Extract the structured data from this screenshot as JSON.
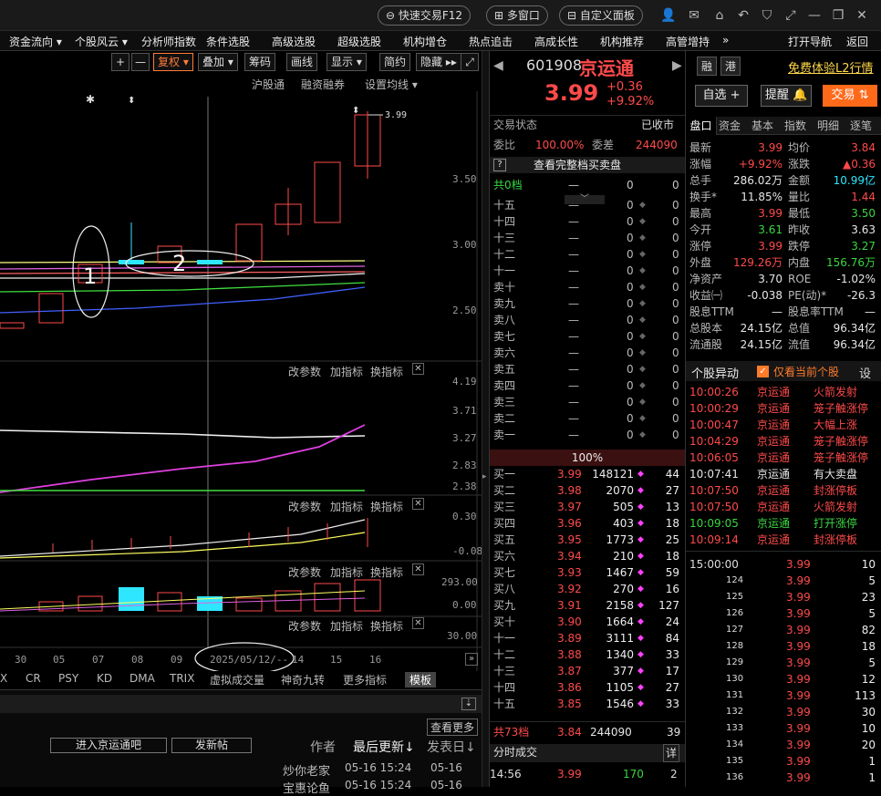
{
  "topbar": {
    "quick_trade": "快速交易F12",
    "multi_window": "多窗口",
    "custom_panel": "自定义面板"
  },
  "menu": [
    "资金流向 ▾",
    "个股风云 ▾",
    "分析师指数",
    "条件选股",
    "高级选股",
    "超级选股",
    "机构增仓",
    "热点追击",
    "高成长性",
    "机构推荐",
    "高管增持",
    "»",
    "打开导航",
    "返回"
  ],
  "chart_toolbar": {
    "fuquan": "复权 ▾",
    "diejia": "叠加 ▾",
    "chouma": "筹码",
    "huaxian": "画线",
    "xianshi": "显示 ▾",
    "jianyue": "简约",
    "yincang": "隐藏 ▸▸"
  },
  "chart_links": [
    "沪股通",
    "融资融券",
    "设置均线 ▾"
  ],
  "price_axis": [
    "3.50",
    "3.00",
    "2.50"
  ],
  "last_price_tag": "3.99",
  "annotations": [
    "1",
    "2"
  ],
  "sub_panels": [
    {
      "labels": [
        "改参数",
        "加指标",
        "换指标"
      ],
      "axis": [
        "4.19",
        "3.71",
        "3.27",
        "2.83",
        "2.38"
      ]
    },
    {
      "labels": [
        "改参数",
        "加指标",
        "换指标"
      ],
      "axis": [
        "0.30",
        "-0.08"
      ]
    },
    {
      "labels": [
        "改参数",
        "加指标",
        "换指标"
      ],
      "axis": [
        "293.00",
        "0.00"
      ]
    },
    {
      "labels": [
        "改参数",
        "加指标",
        "换指标"
      ],
      "axis": [
        "30.00"
      ]
    }
  ],
  "date_axis": [
    "30",
    "05",
    "07",
    "08",
    "09",
    "2025/05/12/--",
    "14",
    "15",
    "16"
  ],
  "indicator_tabs": [
    "X",
    "CR",
    "PSY",
    "KD",
    "DMA",
    "TRIX",
    "虚拟成交量",
    "神奇九转",
    "更多指标",
    "模板"
  ],
  "lower": {
    "more": "查看更多",
    "enter_bar": "进入京运通吧",
    "new_post": "发新帖",
    "author": "作者",
    "last_update": "最后更新↓",
    "post_date": "发表日↓",
    "posts": [
      {
        "author": "炒你老家",
        "update": "05-16 15:24",
        "date": "05-16"
      },
      {
        "author": "宝惠论鱼",
        "update": "05-16 15:24",
        "date": "05-16"
      }
    ]
  },
  "stock": {
    "code": "601908",
    "name": "京运通",
    "price": "3.99",
    "change": "+0.36",
    "change_pct": "+9.92%",
    "rong": "融",
    "gang": "港",
    "l2": "免费体验L2行情",
    "zixuan": "自选 +",
    "tixing": "提醒 🔔",
    "jiaoyi": "交易 ⇅"
  },
  "trade_status": {
    "label": "交易状态",
    "value": "已收市"
  },
  "weibi": {
    "label": "委比",
    "pct": "100.00%",
    "wc_label": "委差",
    "wc": "244090"
  },
  "full_book": "查看完整档买卖盘",
  "sell_header": {
    "label": "共0档",
    "a": "—",
    "b": "0",
    "c": "0"
  },
  "sells": [
    {
      "l": "十五",
      "p": "—",
      "v": "0",
      "n": "0"
    },
    {
      "l": "十四",
      "p": "—",
      "v": "0",
      "n": "0"
    },
    {
      "l": "十三",
      "p": "—",
      "v": "0",
      "n": "0"
    },
    {
      "l": "十二",
      "p": "—",
      "v": "0",
      "n": "0"
    },
    {
      "l": "十一",
      "p": "—",
      "v": "0",
      "n": "0"
    },
    {
      "l": "卖十",
      "p": "—",
      "v": "0",
      "n": "0"
    },
    {
      "l": "卖九",
      "p": "—",
      "v": "0",
      "n": "0"
    },
    {
      "l": "卖八",
      "p": "—",
      "v": "0",
      "n": "0"
    },
    {
      "l": "卖七",
      "p": "—",
      "v": "0",
      "n": "0"
    },
    {
      "l": "卖六",
      "p": "—",
      "v": "0",
      "n": "0"
    },
    {
      "l": "卖五",
      "p": "—",
      "v": "0",
      "n": "0"
    },
    {
      "l": "卖四",
      "p": "—",
      "v": "0",
      "n": "0"
    },
    {
      "l": "卖三",
      "p": "—",
      "v": "0",
      "n": "0"
    },
    {
      "l": "卖二",
      "p": "—",
      "v": "0",
      "n": "0"
    },
    {
      "l": "卖一",
      "p": "—",
      "v": "0",
      "n": "0"
    }
  ],
  "ratio_bar": "100%",
  "buys": [
    {
      "l": "买一",
      "p": "3.99",
      "v": "148121",
      "n": "44"
    },
    {
      "l": "买二",
      "p": "3.98",
      "v": "2070",
      "n": "27"
    },
    {
      "l": "买三",
      "p": "3.97",
      "v": "505",
      "n": "13"
    },
    {
      "l": "买四",
      "p": "3.96",
      "v": "403",
      "n": "18"
    },
    {
      "l": "买五",
      "p": "3.95",
      "v": "1773",
      "n": "25"
    },
    {
      "l": "买六",
      "p": "3.94",
      "v": "210",
      "n": "18"
    },
    {
      "l": "买七",
      "p": "3.93",
      "v": "1467",
      "n": "59"
    },
    {
      "l": "买八",
      "p": "3.92",
      "v": "270",
      "n": "16"
    },
    {
      "l": "买九",
      "p": "3.91",
      "v": "2158",
      "n": "127"
    },
    {
      "l": "买十",
      "p": "3.90",
      "v": "1664",
      "n": "24"
    },
    {
      "l": "十一",
      "p": "3.89",
      "v": "3111",
      "n": "84"
    },
    {
      "l": "十二",
      "p": "3.88",
      "v": "1340",
      "n": "33"
    },
    {
      "l": "十三",
      "p": "3.87",
      "v": "377",
      "n": "17"
    },
    {
      "l": "十四",
      "p": "3.86",
      "v": "1105",
      "n": "27"
    },
    {
      "l": "十五",
      "p": "3.85",
      "v": "1546",
      "n": "33"
    }
  ],
  "buy_footer": {
    "label": "共73档",
    "p": "3.84",
    "v": "244090",
    "n": "39"
  },
  "fenshi": {
    "title": "分时成交",
    "detail": "详",
    "time": "14:56",
    "price": "3.99",
    "vol": "170",
    "n": "2"
  },
  "right_tabs": [
    "盘口",
    "资金",
    "基本",
    "指数",
    "明细",
    "逐笔"
  ],
  "quote": [
    {
      "a": "最新",
      "av": "3.99",
      "b": "均价",
      "bv": "3.84",
      "ac": "red",
      "bc": "red"
    },
    {
      "a": "涨幅",
      "av": "+9.92%",
      "b": "涨跌",
      "bv": "▲0.36",
      "ac": "red",
      "bc": "red"
    },
    {
      "a": "总手",
      "av": "286.02万",
      "b": "金额",
      "bv": "10.99亿",
      "ac": "wht",
      "bc": "cyan"
    },
    {
      "a": "换手*",
      "av": "11.85%",
      "b": "量比",
      "bv": "1.44",
      "ac": "wht",
      "bc": "red"
    },
    {
      "a": "最高",
      "av": "3.99",
      "b": "最低",
      "bv": "3.50",
      "ac": "red",
      "bc": "grn"
    },
    {
      "a": "今开",
      "av": "3.61",
      "b": "昨收",
      "bv": "3.63",
      "ac": "grn",
      "bc": "wht"
    },
    {
      "a": "涨停",
      "av": "3.99",
      "b": "跌停",
      "bv": "3.27",
      "ac": "red",
      "bc": "grn"
    },
    {
      "a": "外盘",
      "av": "129.26万",
      "b": "内盘",
      "bv": "156.76万",
      "ac": "red",
      "bc": "grn"
    },
    {
      "a": "净资产",
      "av": "3.70",
      "b": "ROE",
      "bv": "-1.02%",
      "ac": "wht",
      "bc": "wht"
    },
    {
      "a": "收益㈠",
      "av": "-0.038",
      "b": "PE(动)*",
      "bv": "-26.3",
      "ac": "wht",
      "bc": "wht"
    },
    {
      "a": "股息TTM",
      "av": "—",
      "b": "股息率TTM",
      "bv": "—",
      "ac": "wht",
      "bc": "wht"
    },
    {
      "a": "总股本",
      "av": "24.15亿",
      "b": "总值",
      "bv": "96.34亿",
      "ac": "wht",
      "bc": "wht"
    },
    {
      "a": "流通股",
      "av": "24.15亿",
      "b": "流值",
      "bv": "96.34亿",
      "ac": "wht",
      "bc": "wht"
    }
  ],
  "yidong": {
    "title": "个股异动",
    "only_current": "仅看当前个股",
    "settings": "设"
  },
  "alerts": [
    {
      "t": "10:00:26",
      "n": "京运通",
      "e": "火箭发射",
      "c": "red"
    },
    {
      "t": "10:00:29",
      "n": "京运通",
      "e": "笼子触涨停",
      "c": "red"
    },
    {
      "t": "10:00:47",
      "n": "京运通",
      "e": "大幅上涨",
      "c": "red"
    },
    {
      "t": "10:04:29",
      "n": "京运通",
      "e": "笼子触涨停",
      "c": "red"
    },
    {
      "t": "10:06:05",
      "n": "京运通",
      "e": "笼子触涨停",
      "c": "red"
    },
    {
      "t": "10:07:41",
      "n": "京运通",
      "e": "有大卖盘",
      "c": "wht"
    },
    {
      "t": "10:07:50",
      "n": "京运通",
      "e": "封涨停板",
      "c": "red"
    },
    {
      "t": "10:07:50",
      "n": "京运通",
      "e": "火箭发射",
      "c": "red"
    },
    {
      "t": "10:09:05",
      "n": "京运通",
      "e": "打开涨停",
      "c": "grn"
    },
    {
      "t": "10:09:14",
      "n": "京运通",
      "e": "封涨停板",
      "c": "red"
    }
  ],
  "ticks": [
    {
      "i": "15:00:00",
      "p": "3.99",
      "v": "10"
    },
    {
      "i": "124",
      "p": "3.99",
      "v": "5"
    },
    {
      "i": "125",
      "p": "3.99",
      "v": "23"
    },
    {
      "i": "126",
      "p": "3.99",
      "v": "5"
    },
    {
      "i": "127",
      "p": "3.99",
      "v": "82"
    },
    {
      "i": "128",
      "p": "3.99",
      "v": "18"
    },
    {
      "i": "129",
      "p": "3.99",
      "v": "5"
    },
    {
      "i": "130",
      "p": "3.99",
      "v": "12"
    },
    {
      "i": "131",
      "p": "3.99",
      "v": "113"
    },
    {
      "i": "132",
      "p": "3.99",
      "v": "30"
    },
    {
      "i": "133",
      "p": "3.99",
      "v": "10"
    },
    {
      "i": "134",
      "p": "3.99",
      "v": "20"
    },
    {
      "i": "135",
      "p": "3.99",
      "v": "1"
    },
    {
      "i": "136",
      "p": "3.99",
      "v": "1"
    }
  ]
}
